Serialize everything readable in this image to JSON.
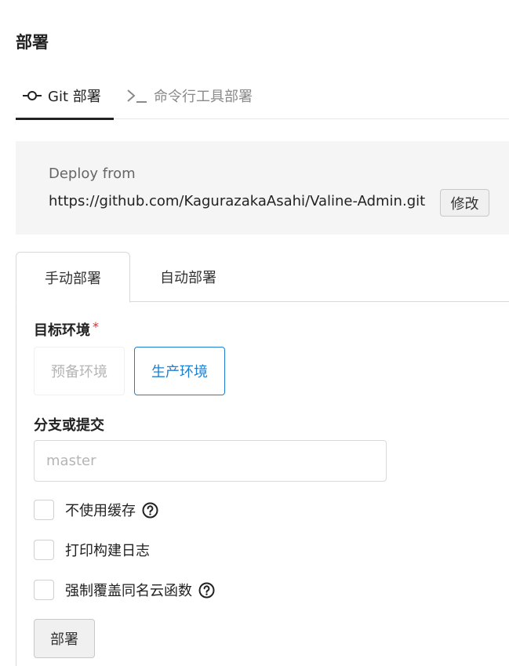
{
  "page": {
    "title": "部署"
  },
  "top_tabs": [
    {
      "label": "Git 部署",
      "icon": "git-commit-icon",
      "active": true
    },
    {
      "label": "命令行工具部署",
      "icon": "terminal-icon",
      "active": false
    }
  ],
  "source": {
    "label": "Deploy from",
    "url": "https://github.com/KagurazakaAsahi/Valine-Admin.git",
    "edit_label": "修改"
  },
  "deploy_tabs": [
    {
      "label": "手动部署",
      "active": true
    },
    {
      "label": "自动部署",
      "active": false
    }
  ],
  "form": {
    "env_label": "目标环境",
    "required_mark": "*",
    "env_options": [
      {
        "label": "预备环境",
        "state": "disabled"
      },
      {
        "label": "生产环境",
        "state": "selected"
      }
    ],
    "branch_label": "分支或提交",
    "branch_placeholder": "master",
    "branch_value": "",
    "options": [
      {
        "label": "不使用缓存",
        "checked": false,
        "help": true
      },
      {
        "label": "打印构建日志",
        "checked": false,
        "help": false
      },
      {
        "label": "强制覆盖同名云函数",
        "checked": false,
        "help": true
      }
    ],
    "submit_label": "部署"
  },
  "colors": {
    "accent": "#1e7fd0",
    "required": "#e0282e",
    "panel_bg": "#f5f5f5"
  }
}
